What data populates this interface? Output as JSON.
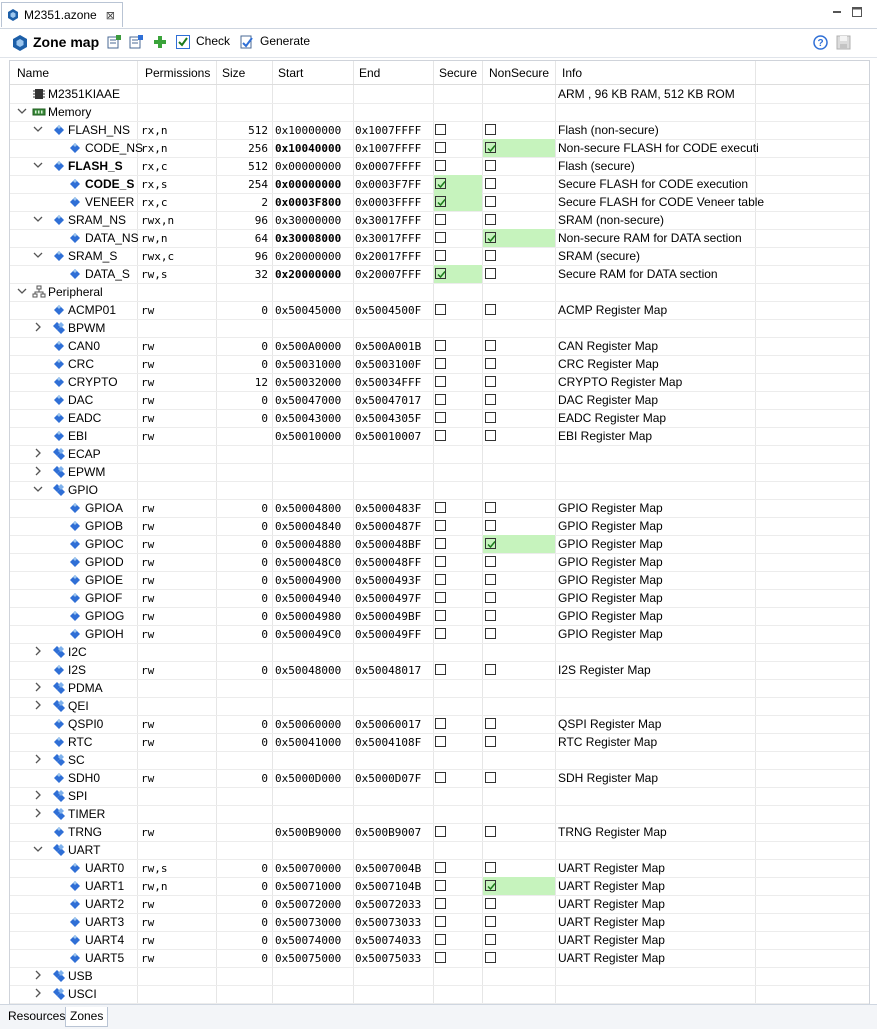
{
  "editor_tab": {
    "title": "M2351.azone",
    "close_glyph": "⊠"
  },
  "toolbar": {
    "title": "Zone map",
    "check_label": "Check",
    "generate_label": "Generate"
  },
  "columns": [
    "Name",
    "Permissions",
    "Size",
    "Start",
    "End",
    "Secure",
    "NonSecure",
    "Info"
  ],
  "rows": [
    {
      "depth": 0,
      "expander": "",
      "icon": "chip-icon",
      "name": "M2351KIAAE",
      "bold": false,
      "perm": "",
      "size": "",
      "start": "",
      "end": "",
      "bold_addr": "",
      "checks": false,
      "secure": false,
      "nonsecure": false,
      "hl": "",
      "info": "ARM , 96 KB RAM, 512 KB ROM"
    },
    {
      "depth": 0,
      "expander": "open",
      "icon": "memory-icon",
      "name": "Memory",
      "bold": false,
      "perm": "",
      "size": "",
      "start": "",
      "end": "",
      "bold_addr": "",
      "checks": false,
      "secure": false,
      "nonsecure": false,
      "hl": "",
      "info": ""
    },
    {
      "depth": 1,
      "expander": "open",
      "icon": "region-icon",
      "name": "FLASH_NS",
      "bold": false,
      "perm": "rx,n",
      "size": "512",
      "start": "0x10000000",
      "end": "0x1007FFFF",
      "bold_addr": "",
      "checks": true,
      "secure": false,
      "nonsecure": false,
      "hl": "",
      "info": "Flash (non-secure)"
    },
    {
      "depth": 2,
      "expander": "",
      "icon": "region-icon",
      "name": "CODE_NS",
      "bold": false,
      "perm": "rx,n",
      "size": "256",
      "start": "0x10040000",
      "end": "0x1007FFFF",
      "bold_addr": "start",
      "checks": true,
      "secure": false,
      "nonsecure": true,
      "hl": "nonsecure",
      "info": "Non-secure FLASH for CODE executi"
    },
    {
      "depth": 1,
      "expander": "open",
      "icon": "region-icon",
      "name": "FLASH_S",
      "bold": true,
      "perm": "rx,c",
      "size": "512",
      "start": "0x00000000",
      "end": "0x0007FFFF",
      "bold_addr": "",
      "checks": true,
      "secure": false,
      "nonsecure": false,
      "hl": "",
      "info": "Flash (secure)"
    },
    {
      "depth": 2,
      "expander": "",
      "icon": "region-icon",
      "name": "CODE_S",
      "bold": true,
      "perm": "rx,s",
      "size": "254",
      "start": "0x00000000",
      "end": "0x0003F7FF",
      "bold_addr": "start",
      "checks": true,
      "secure": true,
      "nonsecure": false,
      "hl": "secure",
      "info": "Secure FLASH for CODE execution"
    },
    {
      "depth": 2,
      "expander": "",
      "icon": "region-icon",
      "name": "VENEER",
      "bold": false,
      "perm": "rx,c",
      "size": "2",
      "start": "0x0003F800",
      "end": "0x0003FFFF",
      "bold_addr": "start",
      "checks": true,
      "secure": true,
      "nonsecure": false,
      "hl": "secure",
      "info": "Secure FLASH for CODE Veneer table"
    },
    {
      "depth": 1,
      "expander": "open",
      "icon": "region-icon",
      "name": "SRAM_NS",
      "bold": false,
      "perm": "rwx,n",
      "size": "96",
      "start": "0x30000000",
      "end": "0x30017FFF",
      "bold_addr": "",
      "checks": true,
      "secure": false,
      "nonsecure": false,
      "hl": "",
      "info": "SRAM (non-secure)"
    },
    {
      "depth": 2,
      "expander": "",
      "icon": "region-icon",
      "name": "DATA_NS",
      "bold": false,
      "perm": "rw,n",
      "size": "64",
      "start": "0x30008000",
      "end": "0x30017FFF",
      "bold_addr": "start",
      "checks": true,
      "secure": false,
      "nonsecure": true,
      "hl": "nonsecure",
      "info": "Non-secure RAM for DATA section"
    },
    {
      "depth": 1,
      "expander": "open",
      "icon": "region-icon",
      "name": "SRAM_S",
      "bold": false,
      "perm": "rwx,c",
      "size": "96",
      "start": "0x20000000",
      "end": "0x20017FFF",
      "bold_addr": "",
      "checks": true,
      "secure": false,
      "nonsecure": false,
      "hl": "",
      "info": "SRAM (secure)"
    },
    {
      "depth": 2,
      "expander": "",
      "icon": "region-icon",
      "name": "DATA_S",
      "bold": false,
      "perm": "rw,s",
      "size": "32",
      "start": "0x20000000",
      "end": "0x20007FFF",
      "bold_addr": "start",
      "checks": true,
      "secure": true,
      "nonsecure": false,
      "hl": "secure",
      "info": "Secure RAM for DATA section"
    },
    {
      "depth": 0,
      "expander": "open",
      "icon": "peripheral-tree-icon",
      "name": "Peripheral",
      "bold": false,
      "perm": "",
      "size": "",
      "start": "",
      "end": "",
      "bold_addr": "",
      "checks": false,
      "secure": false,
      "nonsecure": false,
      "hl": "",
      "info": ""
    },
    {
      "depth": 1,
      "expander": "",
      "icon": "region-icon",
      "name": "ACMP01",
      "bold": false,
      "perm": "rw",
      "size": "0",
      "start": "0x50045000",
      "end": "0x5004500F",
      "bold_addr": "",
      "checks": true,
      "secure": false,
      "nonsecure": false,
      "hl": "",
      "info": "ACMP Register Map"
    },
    {
      "depth": 1,
      "expander": "closed",
      "icon": "group-icon",
      "name": "BPWM",
      "bold": false,
      "perm": "",
      "size": "",
      "start": "",
      "end": "",
      "bold_addr": "",
      "checks": false,
      "secure": false,
      "nonsecure": false,
      "hl": "",
      "info": ""
    },
    {
      "depth": 1,
      "expander": "",
      "icon": "region-icon",
      "name": "CAN0",
      "bold": false,
      "perm": "rw",
      "size": "0",
      "start": "0x500A0000",
      "end": "0x500A001B",
      "bold_addr": "",
      "checks": true,
      "secure": false,
      "nonsecure": false,
      "hl": "",
      "info": "CAN Register Map"
    },
    {
      "depth": 1,
      "expander": "",
      "icon": "region-icon",
      "name": "CRC",
      "bold": false,
      "perm": "rw",
      "size": "0",
      "start": "0x50031000",
      "end": "0x5003100F",
      "bold_addr": "",
      "checks": true,
      "secure": false,
      "nonsecure": false,
      "hl": "",
      "info": "CRC Register Map"
    },
    {
      "depth": 1,
      "expander": "",
      "icon": "region-icon",
      "name": "CRYPTO",
      "bold": false,
      "perm": "rw",
      "size": "12",
      "start": "0x50032000",
      "end": "0x50034FFF",
      "bold_addr": "",
      "checks": true,
      "secure": false,
      "nonsecure": false,
      "hl": "",
      "info": "CRYPTO Register Map"
    },
    {
      "depth": 1,
      "expander": "",
      "icon": "region-icon",
      "name": "DAC",
      "bold": false,
      "perm": "rw",
      "size": "0",
      "start": "0x50047000",
      "end": "0x50047017",
      "bold_addr": "",
      "checks": true,
      "secure": false,
      "nonsecure": false,
      "hl": "",
      "info": "DAC Register Map"
    },
    {
      "depth": 1,
      "expander": "",
      "icon": "region-icon",
      "name": "EADC",
      "bold": false,
      "perm": "rw",
      "size": "0",
      "start": "0x50043000",
      "end": "0x5004305F",
      "bold_addr": "",
      "checks": true,
      "secure": false,
      "nonsecure": false,
      "hl": "",
      "info": "EADC Register Map"
    },
    {
      "depth": 1,
      "expander": "",
      "icon": "region-icon",
      "name": "EBI",
      "bold": false,
      "perm": "rw",
      "size": "",
      "start": "0x50010000",
      "end": "0x50010007",
      "bold_addr": "",
      "checks": true,
      "secure": false,
      "nonsecure": false,
      "hl": "",
      "info": "EBI Register Map"
    },
    {
      "depth": 1,
      "expander": "closed",
      "icon": "group-icon",
      "name": "ECAP",
      "bold": false,
      "perm": "",
      "size": "",
      "start": "",
      "end": "",
      "bold_addr": "",
      "checks": false,
      "secure": false,
      "nonsecure": false,
      "hl": "",
      "info": ""
    },
    {
      "depth": 1,
      "expander": "closed",
      "icon": "group-icon",
      "name": "EPWM",
      "bold": false,
      "perm": "",
      "size": "",
      "start": "",
      "end": "",
      "bold_addr": "",
      "checks": false,
      "secure": false,
      "nonsecure": false,
      "hl": "",
      "info": ""
    },
    {
      "depth": 1,
      "expander": "open",
      "icon": "group-icon",
      "name": "GPIO",
      "bold": false,
      "perm": "",
      "size": "",
      "start": "",
      "end": "",
      "bold_addr": "",
      "checks": false,
      "secure": false,
      "nonsecure": false,
      "hl": "",
      "info": ""
    },
    {
      "depth": 2,
      "expander": "",
      "icon": "region-icon",
      "name": "GPIOA",
      "bold": false,
      "perm": "rw",
      "size": "0",
      "start": "0x50004800",
      "end": "0x5000483F",
      "bold_addr": "",
      "checks": true,
      "secure": false,
      "nonsecure": false,
      "hl": "",
      "info": "GPIO Register Map"
    },
    {
      "depth": 2,
      "expander": "",
      "icon": "region-icon",
      "name": "GPIOB",
      "bold": false,
      "perm": "rw",
      "size": "0",
      "start": "0x50004840",
      "end": "0x5000487F",
      "bold_addr": "",
      "checks": true,
      "secure": false,
      "nonsecure": false,
      "hl": "",
      "info": "GPIO Register Map"
    },
    {
      "depth": 2,
      "expander": "",
      "icon": "region-icon",
      "name": "GPIOC",
      "bold": false,
      "perm": "rw",
      "size": "0",
      "start": "0x50004880",
      "end": "0x500048BF",
      "bold_addr": "",
      "checks": true,
      "secure": false,
      "nonsecure": true,
      "hl": "nonsecure",
      "info": "GPIO Register Map"
    },
    {
      "depth": 2,
      "expander": "",
      "icon": "region-icon",
      "name": "GPIOD",
      "bold": false,
      "perm": "rw",
      "size": "0",
      "start": "0x500048C0",
      "end": "0x500048FF",
      "bold_addr": "",
      "checks": true,
      "secure": false,
      "nonsecure": false,
      "hl": "",
      "info": "GPIO Register Map"
    },
    {
      "depth": 2,
      "expander": "",
      "icon": "region-icon",
      "name": "GPIOE",
      "bold": false,
      "perm": "rw",
      "size": "0",
      "start": "0x50004900",
      "end": "0x5000493F",
      "bold_addr": "",
      "checks": true,
      "secure": false,
      "nonsecure": false,
      "hl": "",
      "info": "GPIO Register Map"
    },
    {
      "depth": 2,
      "expander": "",
      "icon": "region-icon",
      "name": "GPIOF",
      "bold": false,
      "perm": "rw",
      "size": "0",
      "start": "0x50004940",
      "end": "0x5000497F",
      "bold_addr": "",
      "checks": true,
      "secure": false,
      "nonsecure": false,
      "hl": "",
      "info": "GPIO Register Map"
    },
    {
      "depth": 2,
      "expander": "",
      "icon": "region-icon",
      "name": "GPIOG",
      "bold": false,
      "perm": "rw",
      "size": "0",
      "start": "0x50004980",
      "end": "0x500049BF",
      "bold_addr": "",
      "checks": true,
      "secure": false,
      "nonsecure": false,
      "hl": "",
      "info": "GPIO Register Map"
    },
    {
      "depth": 2,
      "expander": "",
      "icon": "region-icon",
      "name": "GPIOH",
      "bold": false,
      "perm": "rw",
      "size": "0",
      "start": "0x500049C0",
      "end": "0x500049FF",
      "bold_addr": "",
      "checks": true,
      "secure": false,
      "nonsecure": false,
      "hl": "",
      "info": "GPIO Register Map"
    },
    {
      "depth": 1,
      "expander": "closed",
      "icon": "group-icon",
      "name": "I2C",
      "bold": false,
      "perm": "",
      "size": "",
      "start": "",
      "end": "",
      "bold_addr": "",
      "checks": false,
      "secure": false,
      "nonsecure": false,
      "hl": "",
      "info": ""
    },
    {
      "depth": 1,
      "expander": "",
      "icon": "region-icon",
      "name": "I2S",
      "bold": false,
      "perm": "rw",
      "size": "0",
      "start": "0x50048000",
      "end": "0x50048017",
      "bold_addr": "",
      "checks": true,
      "secure": false,
      "nonsecure": false,
      "hl": "",
      "info": "I2S Register Map"
    },
    {
      "depth": 1,
      "expander": "closed",
      "icon": "group-icon",
      "name": "PDMA",
      "bold": false,
      "perm": "",
      "size": "",
      "start": "",
      "end": "",
      "bold_addr": "",
      "checks": false,
      "secure": false,
      "nonsecure": false,
      "hl": "",
      "info": ""
    },
    {
      "depth": 1,
      "expander": "closed",
      "icon": "group-icon",
      "name": "QEI",
      "bold": false,
      "perm": "",
      "size": "",
      "start": "",
      "end": "",
      "bold_addr": "",
      "checks": false,
      "secure": false,
      "nonsecure": false,
      "hl": "",
      "info": ""
    },
    {
      "depth": 1,
      "expander": "",
      "icon": "region-icon",
      "name": "QSPI0",
      "bold": false,
      "perm": "rw",
      "size": "0",
      "start": "0x50060000",
      "end": "0x50060017",
      "bold_addr": "",
      "checks": true,
      "secure": false,
      "nonsecure": false,
      "hl": "",
      "info": "QSPI Register Map"
    },
    {
      "depth": 1,
      "expander": "",
      "icon": "region-icon",
      "name": "RTC",
      "bold": false,
      "perm": "rw",
      "size": "0",
      "start": "0x50041000",
      "end": "0x5004108F",
      "bold_addr": "",
      "checks": true,
      "secure": false,
      "nonsecure": false,
      "hl": "",
      "info": "RTC Register Map"
    },
    {
      "depth": 1,
      "expander": "closed",
      "icon": "group-icon",
      "name": "SC",
      "bold": false,
      "perm": "",
      "size": "",
      "start": "",
      "end": "",
      "bold_addr": "",
      "checks": false,
      "secure": false,
      "nonsecure": false,
      "hl": "",
      "info": ""
    },
    {
      "depth": 1,
      "expander": "",
      "icon": "region-icon",
      "name": "SDH0",
      "bold": false,
      "perm": "rw",
      "size": "0",
      "start": "0x5000D000",
      "end": "0x5000D07F",
      "bold_addr": "",
      "checks": true,
      "secure": false,
      "nonsecure": false,
      "hl": "",
      "info": "SDH Register Map"
    },
    {
      "depth": 1,
      "expander": "closed",
      "icon": "group-icon",
      "name": "SPI",
      "bold": false,
      "perm": "",
      "size": "",
      "start": "",
      "end": "",
      "bold_addr": "",
      "checks": false,
      "secure": false,
      "nonsecure": false,
      "hl": "",
      "info": ""
    },
    {
      "depth": 1,
      "expander": "closed",
      "icon": "group-icon",
      "name": "TIMER",
      "bold": false,
      "perm": "",
      "size": "",
      "start": "",
      "end": "",
      "bold_addr": "",
      "checks": false,
      "secure": false,
      "nonsecure": false,
      "hl": "",
      "info": ""
    },
    {
      "depth": 1,
      "expander": "",
      "icon": "region-icon",
      "name": "TRNG",
      "bold": false,
      "perm": "rw",
      "size": "",
      "start": "0x500B9000",
      "end": "0x500B9007",
      "bold_addr": "",
      "checks": true,
      "secure": false,
      "nonsecure": false,
      "hl": "",
      "info": "TRNG Register Map"
    },
    {
      "depth": 1,
      "expander": "open",
      "icon": "group-icon",
      "name": "UART",
      "bold": false,
      "perm": "",
      "size": "",
      "start": "",
      "end": "",
      "bold_addr": "",
      "checks": false,
      "secure": false,
      "nonsecure": false,
      "hl": "",
      "info": ""
    },
    {
      "depth": 2,
      "expander": "",
      "icon": "region-icon",
      "name": "UART0",
      "bold": false,
      "perm": "rw,s",
      "size": "0",
      "start": "0x50070000",
      "end": "0x5007004B",
      "bold_addr": "",
      "checks": true,
      "secure": false,
      "nonsecure": false,
      "hl": "",
      "info": "UART Register Map"
    },
    {
      "depth": 2,
      "expander": "",
      "icon": "region-icon",
      "name": "UART1",
      "bold": false,
      "perm": "rw,n",
      "size": "0",
      "start": "0x50071000",
      "end": "0x5007104B",
      "bold_addr": "",
      "checks": true,
      "secure": false,
      "nonsecure": true,
      "hl": "nonsecure",
      "info": "UART Register Map"
    },
    {
      "depth": 2,
      "expander": "",
      "icon": "region-icon",
      "name": "UART2",
      "bold": false,
      "perm": "rw",
      "size": "0",
      "start": "0x50072000",
      "end": "0x50072033",
      "bold_addr": "",
      "checks": true,
      "secure": false,
      "nonsecure": false,
      "hl": "",
      "info": "UART Register Map"
    },
    {
      "depth": 2,
      "expander": "",
      "icon": "region-icon",
      "name": "UART3",
      "bold": false,
      "perm": "rw",
      "size": "0",
      "start": "0x50073000",
      "end": "0x50073033",
      "bold_addr": "",
      "checks": true,
      "secure": false,
      "nonsecure": false,
      "hl": "",
      "info": "UART Register Map"
    },
    {
      "depth": 2,
      "expander": "",
      "icon": "region-icon",
      "name": "UART4",
      "bold": false,
      "perm": "rw",
      "size": "0",
      "start": "0x50074000",
      "end": "0x50074033",
      "bold_addr": "",
      "checks": true,
      "secure": false,
      "nonsecure": false,
      "hl": "",
      "info": "UART Register Map"
    },
    {
      "depth": 2,
      "expander": "",
      "icon": "region-icon",
      "name": "UART5",
      "bold": false,
      "perm": "rw",
      "size": "0",
      "start": "0x50075000",
      "end": "0x50075033",
      "bold_addr": "",
      "checks": true,
      "secure": false,
      "nonsecure": false,
      "hl": "",
      "info": "UART Register Map"
    },
    {
      "depth": 1,
      "expander": "closed",
      "icon": "group-icon",
      "name": "USB",
      "bold": false,
      "perm": "",
      "size": "",
      "start": "",
      "end": "",
      "bold_addr": "",
      "checks": false,
      "secure": false,
      "nonsecure": false,
      "hl": "",
      "info": ""
    },
    {
      "depth": 1,
      "expander": "closed",
      "icon": "group-icon",
      "name": "USCI",
      "bold": false,
      "perm": "",
      "size": "",
      "start": "",
      "end": "",
      "bold_addr": "",
      "checks": false,
      "secure": false,
      "nonsecure": false,
      "hl": "",
      "info": ""
    }
  ],
  "bottom_tabs": [
    {
      "label": "Resources",
      "active": false
    },
    {
      "label": "Zones",
      "active": true
    }
  ],
  "colors": {
    "secure_highlight": "#c6f3bd",
    "nonsecure_highlight": "#c6f3bd",
    "region_icon": "#2f6fd6",
    "group_icon": "#2f6fd6",
    "zone_icon": "#1d5fa8",
    "check_mark": "#1b7a1b"
  }
}
